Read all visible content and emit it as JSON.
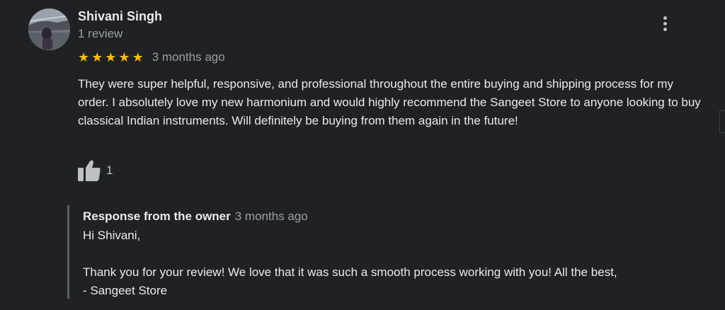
{
  "review": {
    "author_name": "Shivani Singh",
    "author_review_count": "1 review",
    "rating": 5,
    "stars": [
      "★",
      "★",
      "★",
      "★",
      "★"
    ],
    "date": "3 months ago",
    "text": "They were super helpful, responsive, and professional throughout the entire buying and shipping process for my order. I absolutely love my new harmonium and would highly recommend the Sangeet Store to anyone looking to buy classical Indian instruments. Will definitely be buying from them again in the future!",
    "like_count": "1"
  },
  "owner_response": {
    "title": "Response from the owner",
    "date": "3 months ago",
    "greeting": "Hi Shivani,",
    "body": "Thank you for your review! We love that it was such a smooth process working with you! All the best,",
    "signature": "- Sangeet Store"
  },
  "colors": {
    "background": "#202124",
    "star": "#fbbc04",
    "primary_text": "#e8eaed",
    "secondary_text": "#9aa0a6"
  },
  "icons": {
    "menu": "more-vert-icon",
    "like": "thumbs-up-icon"
  }
}
